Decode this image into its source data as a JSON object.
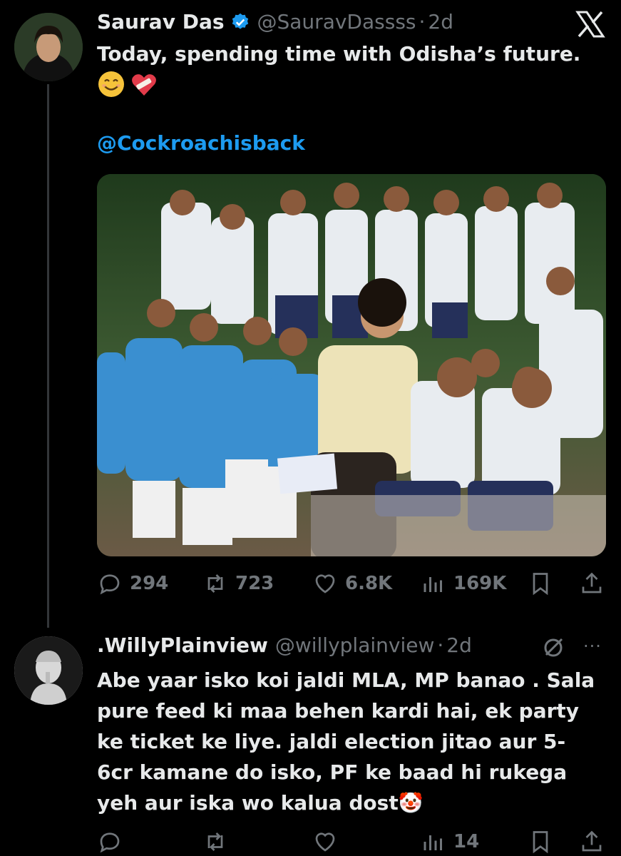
{
  "tweet": {
    "author_name": "Saurav Das",
    "handle": "@SauravDassss",
    "separator": "·",
    "time": "2d",
    "text": "Today, spending time with Odisha’s future.",
    "emojis": [
      "😊",
      "❤️‍🩹"
    ],
    "mention": "@Cockroachisback",
    "stats": {
      "replies": "294",
      "reposts": "723",
      "likes": "6.8K",
      "views": "169K"
    }
  },
  "reply": {
    "author_name": ".WillyPlainview",
    "handle": "@willyplainview",
    "separator": "·",
    "time": "2d",
    "text": "Abe yaar isko koi jaldi MLA, MP banao . Sala pure feed ki maa behen kardi hai, ek party ke ticket ke liye. jaldi election jitao aur 5-6cr kamane do isko, PF ke baad hi rukega yeh aur iska wo kalua dost🤡",
    "more_label": "···",
    "stats": {
      "replies": "",
      "reposts": "",
      "likes": "",
      "views": "14"
    }
  },
  "colors": {
    "background": "#000000",
    "text": "#e7e9ea",
    "muted": "#71767b",
    "accent": "#1d9bf0"
  },
  "icons": [
    "x-logo-icon",
    "verified-badge-icon",
    "reply-icon",
    "repost-icon",
    "like-icon",
    "views-icon",
    "bookmark-icon",
    "share-icon",
    "grok-icon",
    "more-icon"
  ]
}
